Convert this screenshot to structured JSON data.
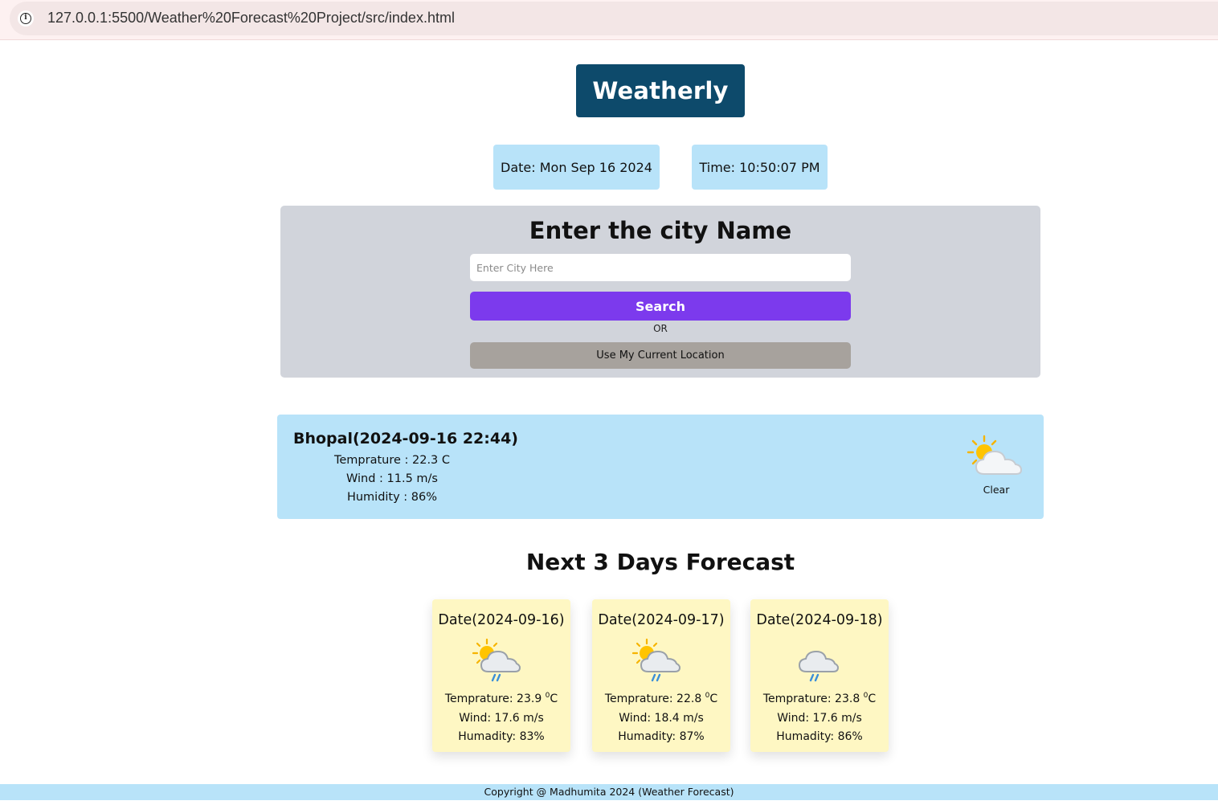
{
  "browser": {
    "url": "127.0.0.1:5500/Weather%20Forecast%20Project/src/index.html"
  },
  "header": {
    "logo": "Weatherly",
    "date_label": "Date: Mon Sep 16 2024",
    "time_label": "Time: 10:50:07 PM"
  },
  "search": {
    "title": "Enter the city Name",
    "placeholder": "Enter City Here",
    "value": "",
    "search_label": "Search",
    "or_label": "OR",
    "location_label": "Use My Current Location"
  },
  "current": {
    "heading": "Bhopal(2024-09-16 22:44)",
    "temperature": "Temprature : 22.3 C",
    "wind": "Wind : 11.5 m/s",
    "humidity": "Humidity : 86%",
    "condition": "Clear",
    "icon": "partly-cloudy-icon"
  },
  "forecast": {
    "title": "Next 3 Days Forecast",
    "days": [
      {
        "date": "Date(2024-09-16)",
        "temp_prefix": "Temprature: 23.9 ",
        "temp_sup": "0",
        "temp_unit": "C",
        "wind": "Wind: 17.6 m/s",
        "humidity": "Humadity: 83%",
        "icon": "sun-cloud-rain-icon"
      },
      {
        "date": "Date(2024-09-17)",
        "temp_prefix": "Temprature: 22.8 ",
        "temp_sup": "0",
        "temp_unit": "C",
        "wind": "Wind: 18.4 m/s",
        "humidity": "Humadity: 87%",
        "icon": "sun-cloud-rain-icon"
      },
      {
        "date": "Date(2024-09-18)",
        "temp_prefix": "Temprature: 23.8 ",
        "temp_sup": "0",
        "temp_unit": "C",
        "wind": "Wind: 17.6 m/s",
        "humidity": "Humadity: 86%",
        "icon": "cloud-rain-icon"
      }
    ]
  },
  "footer": {
    "text": "Copyright @ Madhumita 2024 (Weather Forecast)"
  },
  "colors": {
    "logo_bg": "#0d4a6b",
    "chip_bg": "#b8e3f9",
    "panel_bg": "#d1d4db",
    "search_button": "#7c3aed",
    "location_button": "#a7a29d",
    "forecast_card": "#fef7c3"
  }
}
